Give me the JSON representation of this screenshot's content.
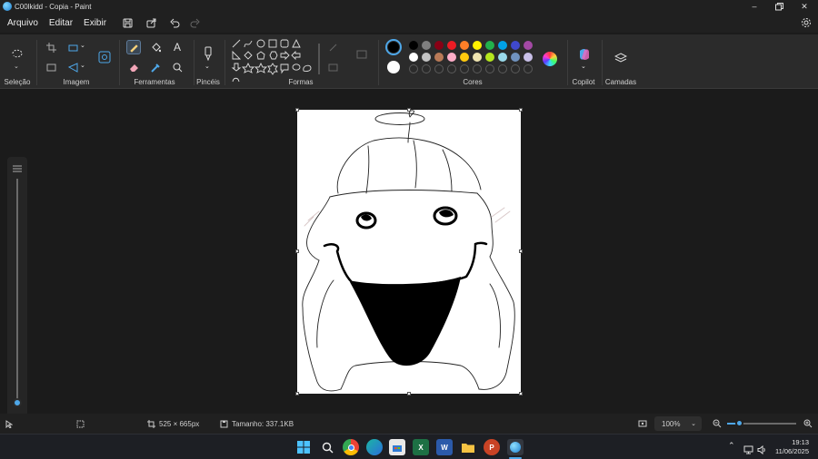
{
  "window": {
    "title": "C00lkidd - Copia - Paint"
  },
  "menu": {
    "file": "Arquivo",
    "edit": "Editar",
    "view": "Exibir"
  },
  "ribbon": {
    "groups": {
      "selection": "Seleção",
      "image": "Imagem",
      "tools": "Ferramentas",
      "brushes": "Pincéis",
      "shapes": "Formas",
      "colors": "Cores",
      "copilot": "Copilot",
      "layers": "Camadas"
    },
    "colors": {
      "primary": "#000000",
      "secondary": "#ffffff",
      "row1": [
        "#000000",
        "#7f7f7f",
        "#880015",
        "#ed1c24",
        "#ff7f27",
        "#fff200",
        "#22b14c",
        "#00a2e8",
        "#3f48cc",
        "#a349a4"
      ],
      "row2": [
        "#ffffff",
        "#c3c3c3",
        "#b97a57",
        "#ffaec9",
        "#ffc90e",
        "#efe4b0",
        "#b5e61d",
        "#99d9ea",
        "#7092be",
        "#c8bfe7"
      ]
    }
  },
  "status": {
    "dimensions": "525 × 665px",
    "size": "Tamanho: 337.1KB",
    "zoom": "100%"
  },
  "taskbar": {
    "time": "19:13",
    "date": "11/06/2025"
  }
}
